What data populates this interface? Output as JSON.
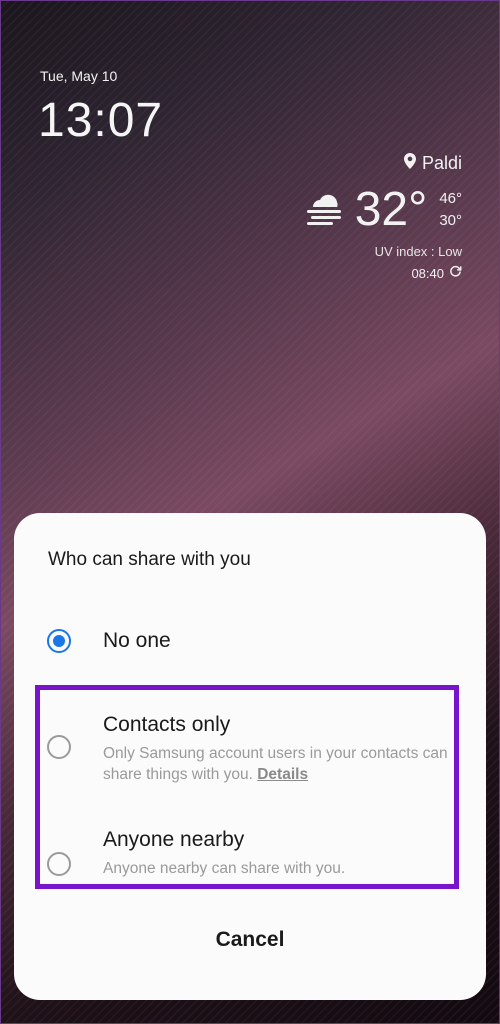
{
  "lockscreen": {
    "date": "Tue, May 10",
    "time": "13:07",
    "weather": {
      "location": "Paldi",
      "location_icon": "location-pin-icon",
      "condition_icon": "cloud-fog-icon",
      "temperature": "32°",
      "high": "46°",
      "low": "30°",
      "uv_index": "UV index : Low",
      "updated_time": "08:40",
      "refresh_icon": "refresh-icon"
    }
  },
  "dialog": {
    "title": "Who can share with you",
    "options": [
      {
        "label": "No one",
        "description": "",
        "selected": true
      },
      {
        "label": "Contacts only",
        "description": "Only Samsung account users in your contacts can share things with you.",
        "link": "Details",
        "selected": false
      },
      {
        "label": "Anyone nearby",
        "description": "Anyone nearby can share with you.",
        "selected": false
      }
    ],
    "cancel_label": "Cancel"
  },
  "colors": {
    "accent": "#1a78e6",
    "highlight_border": "#7a14cc",
    "sheet_background": "#fbfbfb"
  }
}
